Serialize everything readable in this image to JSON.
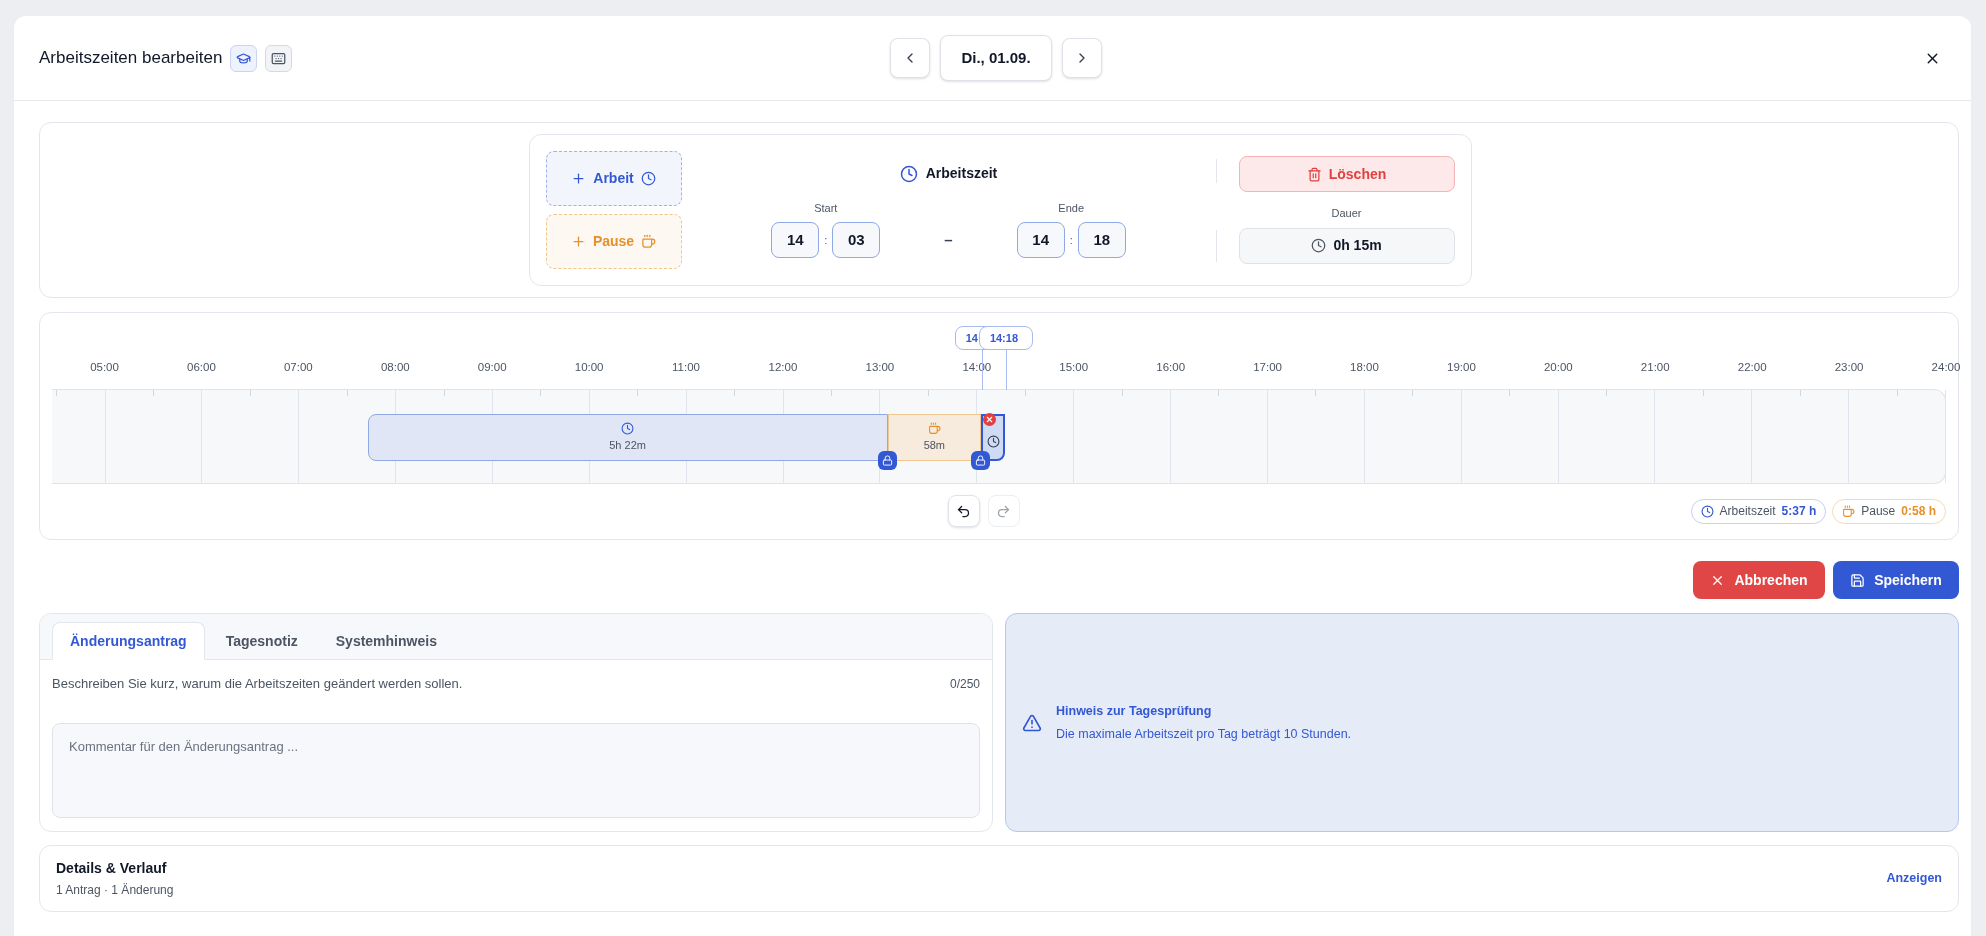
{
  "dialog": {
    "title": "Arbeitszeiten bearbeiten",
    "date": "Di., 01.09."
  },
  "editor": {
    "add_buttons": [
      {
        "kind": "work",
        "label": "Arbeit"
      },
      {
        "kind": "break",
        "label": "Pause"
      }
    ],
    "entry_title": "Arbeitszeit",
    "start_label": "Start",
    "start_hour": "14",
    "start_minute": "03",
    "time_separator": ":",
    "range_dash": "–",
    "end_label": "Ende",
    "end_hour": "14",
    "end_minute": "18",
    "delete_label": "Löschen",
    "duration_label": "Dauer",
    "duration": "0h 15m"
  },
  "timeline": {
    "tips": [
      "14",
      "14:18"
    ],
    "hours": [
      "05:00",
      "06:00",
      "07:00",
      "08:00",
      "09:00",
      "10:00",
      "11:00",
      "12:00",
      "13:00",
      "14:00",
      "15:00",
      "16:00",
      "17:00",
      "18:00",
      "19:00",
      "20:00",
      "21:00",
      "22:00",
      "23:00",
      "24:00"
    ],
    "blocks": [
      {
        "kind": "work",
        "label": "5h 22m",
        "locked": true,
        "selected": false
      },
      {
        "kind": "break",
        "label": "58m",
        "locked": true,
        "selected": false
      },
      {
        "kind": "work",
        "locked": false,
        "selected": true
      }
    ],
    "undo": {
      "disabled": false
    },
    "redo": {
      "disabled": true
    },
    "totals": [
      {
        "kind": "work",
        "label": "Arbeitszeit",
        "value": "5:37 h"
      },
      {
        "kind": "break",
        "label": "Pause",
        "value": "0:58 h"
      }
    ]
  },
  "actions": [
    {
      "kind": "cancel",
      "label": "Abbrechen"
    },
    {
      "kind": "save",
      "label": "Speichern"
    }
  ],
  "notes": {
    "tabs": [
      {
        "label": "Änderungsantrag",
        "selected": true
      },
      {
        "label": "Tagesnotiz",
        "selected": false
      },
      {
        "label": "Systemhinweis",
        "selected": false
      }
    ],
    "description": "Beschreiben Sie kurz, warum die Arbeitszeiten geändert werden sollen.",
    "counter": "0/250",
    "placeholder": "Kommentar für den Änderungsantrag ..."
  },
  "hint": {
    "title": "Hinweis zur Tagesprüfung",
    "text": "Die maximale Arbeitszeit pro Tag beträgt 10 Stunden."
  },
  "details": {
    "title": "Details & Verlauf",
    "subtitle": "1 Antrag · 1 Änderung",
    "link": "Anzeigen"
  }
}
